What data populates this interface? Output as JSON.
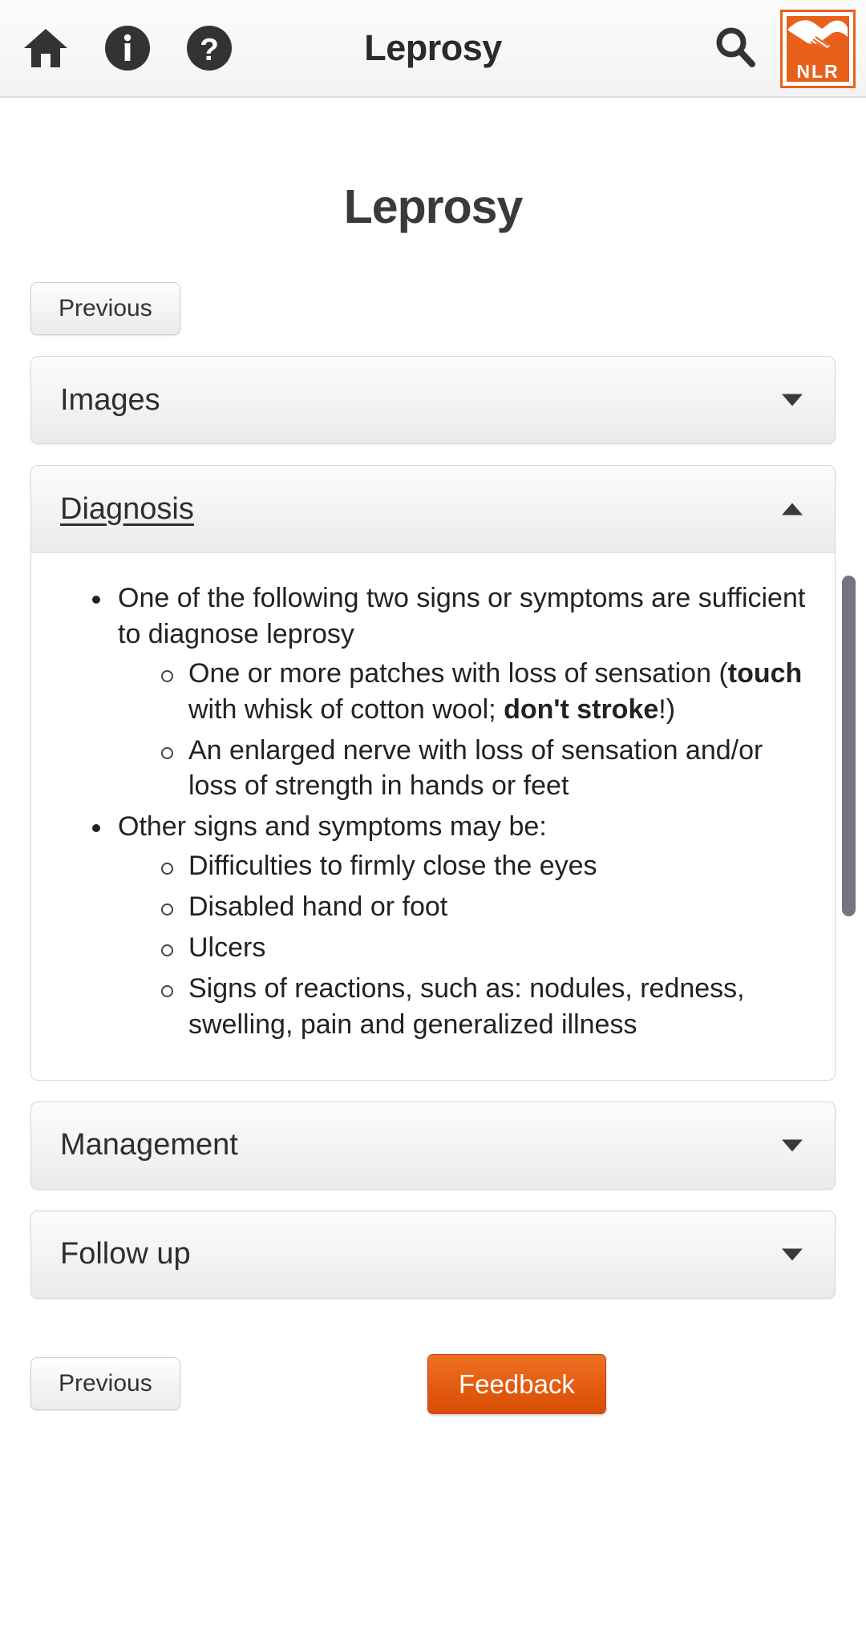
{
  "header": {
    "title": "Leprosy",
    "icons": {
      "home": "home-icon",
      "info": "info-circle-icon",
      "help": "question-circle-icon",
      "search": "search-icon"
    },
    "logo": {
      "text": "NLR",
      "alt": "nlr-logo",
      "color": "#e8611c"
    }
  },
  "page": {
    "title": "Leprosy",
    "previous_label": "Previous"
  },
  "accordions": [
    {
      "id": "images",
      "label": "Images",
      "expanded": false,
      "caret": "chevron-down-icon"
    },
    {
      "id": "diagnosis",
      "label": "Diagnosis",
      "expanded": true,
      "caret": "chevron-up-icon"
    },
    {
      "id": "management",
      "label": "Management",
      "expanded": false,
      "caret": "chevron-down-icon"
    },
    {
      "id": "followup",
      "label": "Follow up",
      "expanded": false,
      "caret": "chevron-down-icon"
    }
  ],
  "diagnosis_content": {
    "items": [
      {
        "text": "One of the following two signs or symptoms are sufficient to diagnose leprosy",
        "children": [
          {
            "html": "One or more patches with loss of sensation (<b>touch</b> with whisk of cotton wool; <b>don't stroke</b>!)",
            "text": "One or more patches with loss of sensation (touch with whisk of cotton wool; don't stroke!)"
          },
          {
            "html": "An enlarged nerve with loss of sensation and/or loss of strength in hands or feet",
            "text": "An enlarged nerve with loss of sensation and/or loss of strength in hands or feet"
          }
        ]
      },
      {
        "text": "Other signs and symptoms may be:",
        "children": [
          {
            "html": "Difficulties to firmly close the eyes",
            "text": "Difficulties to firmly close the eyes"
          },
          {
            "html": "Disabled hand or foot",
            "text": "Disabled hand or foot"
          },
          {
            "html": "Ulcers",
            "text": "Ulcers"
          },
          {
            "html": "Signs of reactions, such as: nodules, redness, swelling, pain and generalized illness",
            "text": "Signs of reactions, such as: nodules, redness, swelling, pain and generalized illness"
          }
        ]
      }
    ]
  },
  "footer": {
    "previous_label": "Previous",
    "feedback_label": "Feedback",
    "feedback_color": "#e35b10"
  }
}
